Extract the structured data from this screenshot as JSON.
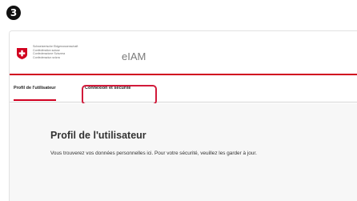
{
  "step": {
    "badge": "3"
  },
  "header": {
    "confederation_names": [
      "Schweizerische Eidgenossenschaft",
      "Confédération suisse",
      "Confederazione Svizzera",
      "Confederaziun svizra"
    ],
    "app_title": "eIAM"
  },
  "nav": {
    "tabs": [
      {
        "label": "Profil de l'utilisateur",
        "active": true
      },
      {
        "label": "Connexion et sécurité",
        "highlighted": true
      }
    ]
  },
  "main": {
    "title": "Profil de l'utilisateur",
    "intro": "Vous trouverez vos données personnelles ici. Pour votre sécurité, veuillez les garder à jour."
  },
  "colors": {
    "accent_red": "#d1001f",
    "highlight": "#d11a3a",
    "content_bg": "#f7f7f7"
  },
  "icons": {
    "logo": "swiss-flag-icon"
  }
}
